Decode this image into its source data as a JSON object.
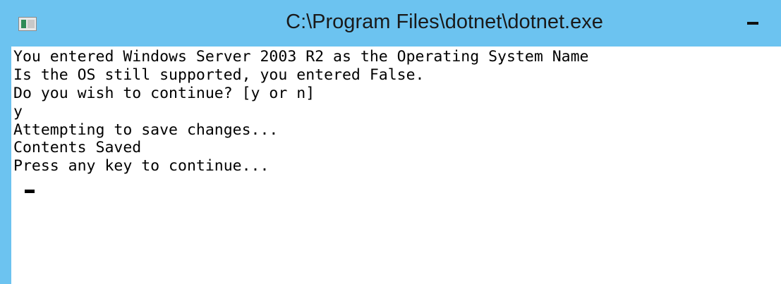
{
  "window": {
    "title": "C:\\Program Files\\dotnet\\dotnet.exe",
    "icon": "console-app-icon",
    "minimize_icon": "minimize-icon",
    "titlebar_color": "#6cc3f0",
    "console_background": "#ffffff",
    "text_color": "#000000"
  },
  "console": {
    "lines": [
      "You entered Windows Server 2003 R2 as the Operating System Name",
      "Is the OS still supported, you entered False.",
      "Do you wish to continue? [y or n]",
      "y",
      "Attempting to save changes...",
      "Contents Saved",
      "Press any key to continue..."
    ]
  }
}
